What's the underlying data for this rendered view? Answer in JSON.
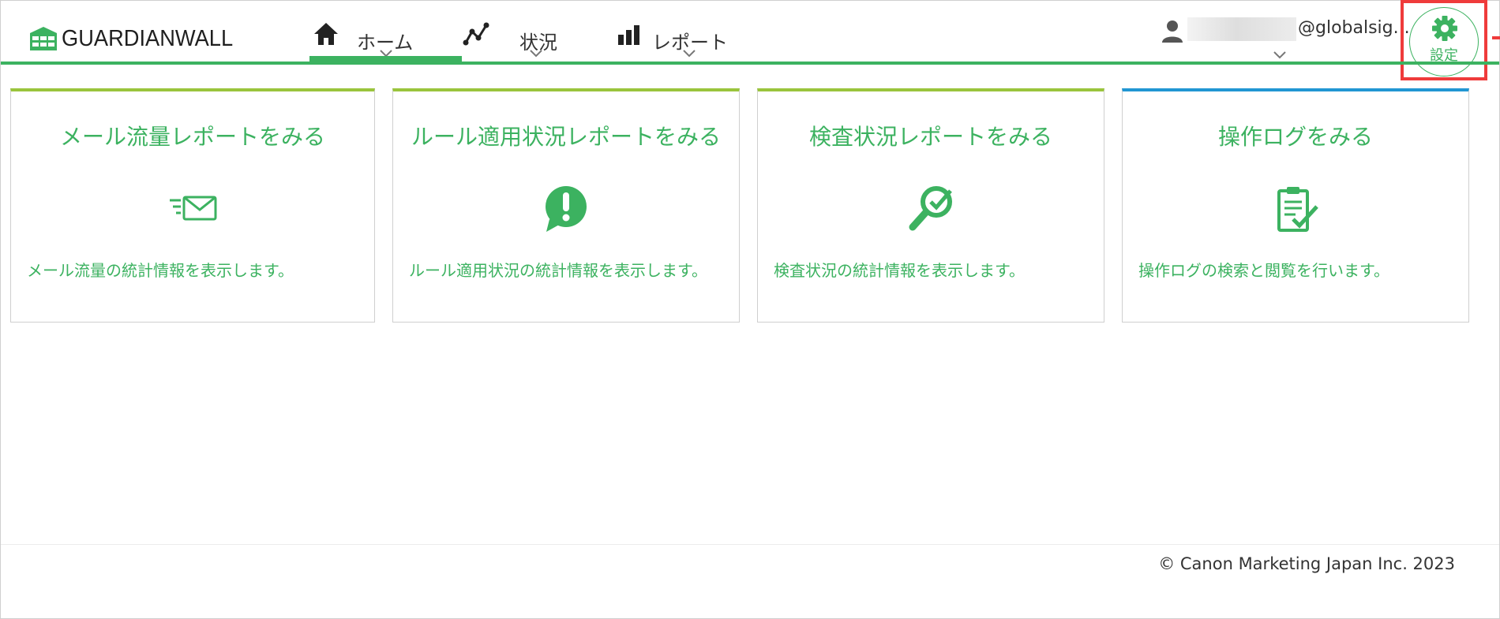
{
  "header": {
    "logo_text": "GUARDIANWALL",
    "nav": [
      {
        "label": "ホーム",
        "icon": "home-icon"
      },
      {
        "label": "状況",
        "icon": "line-chart-icon"
      },
      {
        "label": "レポート",
        "icon": "bar-chart-icon"
      }
    ],
    "user": {
      "email": "@globalsig..."
    },
    "settings": {
      "label": "設定",
      "icon": "gear-icon"
    }
  },
  "cards": [
    {
      "title": "メール流量レポートをみる",
      "description": "メール流量の統計情報を表示します。",
      "icon": "mail-speed-icon",
      "accent": "#9ac43c"
    },
    {
      "title": "ルール適用状況レポートをみる",
      "description": "ルール適用状況の統計情報を表示します。",
      "icon": "exclamation-bubble-icon",
      "accent": "#9ac43c"
    },
    {
      "title": "検査状況レポートをみる",
      "description": "検査状況の統計情報を表示します。",
      "icon": "magnifier-check-icon",
      "accent": "#9ac43c"
    },
    {
      "title": "操作ログをみる",
      "description": "操作ログの検索と閲覧を行います。",
      "icon": "clipboard-check-icon",
      "accent": "#2196d3"
    }
  ],
  "footer": {
    "copyright": "© Canon Marketing Japan Inc. 2023"
  },
  "colors": {
    "brand_green": "#3cb260",
    "card_accent_green": "#9ac43c",
    "card_accent_blue": "#2196d3",
    "highlight_red": "#ef3b3b"
  }
}
